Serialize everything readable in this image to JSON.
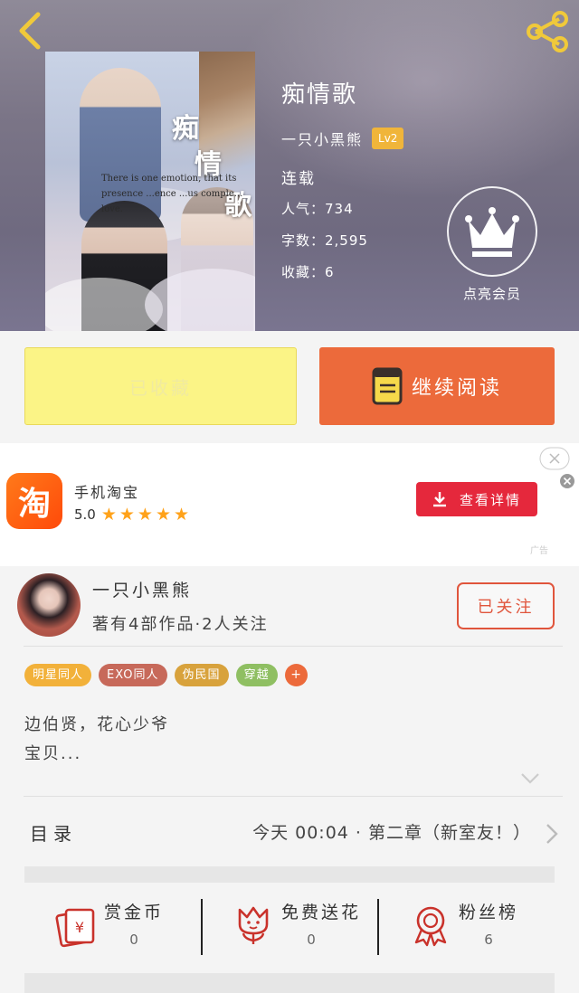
{
  "header": {
    "back_icon": "chevron-left-icon",
    "share_icon": "share-icon"
  },
  "cover": {
    "title_chars": [
      "痴",
      "情",
      "歌"
    ],
    "quote": "There is one emotion, that its presence ...ence ...us comple... love."
  },
  "book": {
    "title": "痴情歌",
    "author": "一只小黑熊",
    "level": "Lv2",
    "status": "连载",
    "popularity": "人气：734",
    "word_count": "字数：2,595",
    "favorites": "收藏：6"
  },
  "vip": {
    "label": "点亮会员",
    "icon": "crown-icon"
  },
  "actions": {
    "collected_label": "已收藏",
    "read_label": "继续阅读",
    "collected_color": "#fbf486",
    "read_color": "#ec6a3b"
  },
  "ad": {
    "app_logo_char": "淘",
    "app_name": "手机淘宝",
    "rating": "5.0",
    "stars": "★★★★★",
    "button_label": "查看详情",
    "tag": "广告",
    "button_color": "#e5283c"
  },
  "author_card": {
    "name": "一只小黑熊",
    "works": "著有4部作品·2人关注",
    "follow_label": "已关注",
    "tags": [
      {
        "label": "明星同人",
        "color": "#f2b13a"
      },
      {
        "label": "EXO同人",
        "color": "#c7695a"
      },
      {
        "label": "伪民国",
        "color": "#d8a23c"
      },
      {
        "label": "穿越",
        "color": "#8fbf62"
      }
    ],
    "more_tag": "+",
    "summary_line1": "边伯贤，花心少爷",
    "summary_line2": "宝贝..."
  },
  "toc": {
    "label": "目录",
    "latest": "今天 00:04 · 第二章（新室友！）"
  },
  "stats": {
    "reward_label": "赏金币",
    "reward_value": "0",
    "flower_label": "免费送花",
    "flower_value": "0",
    "fans_label": "粉丝榜",
    "fans_value": "6"
  }
}
